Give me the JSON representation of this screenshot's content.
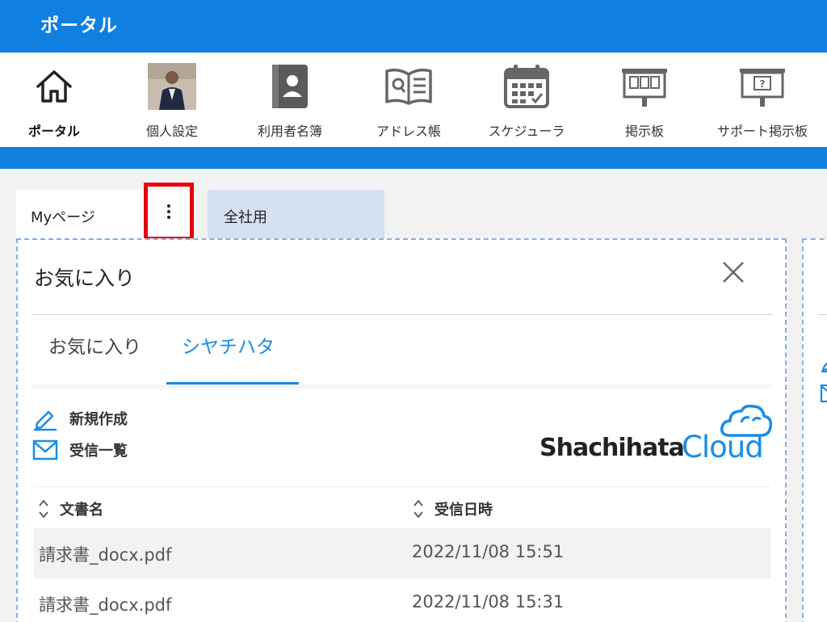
{
  "header": {
    "title": "ポータル"
  },
  "apps": [
    {
      "label": "ポータル",
      "icon": "home-icon",
      "active": true
    },
    {
      "label": "個人設定",
      "icon": "user-photo-avatar"
    },
    {
      "label": "利用者名簿",
      "icon": "contact-book-icon"
    },
    {
      "label": "アドレス帳",
      "icon": "address-book-icon"
    },
    {
      "label": "スケジューラ",
      "icon": "calendar-icon"
    },
    {
      "label": "掲示板",
      "icon": "bulletin-board-icon"
    },
    {
      "label": "サポート掲示板",
      "icon": "support-board-icon"
    }
  ],
  "page_tabs": {
    "my": "Myページ",
    "company": "全社用"
  },
  "widget": {
    "title": "お気に入り",
    "tabs": [
      "お気に入り",
      "シヤチハタ"
    ],
    "active_tab": 1,
    "actions": {
      "new": "新規作成",
      "inbox": "受信一覧"
    },
    "logo": {
      "word1": "Shachihata",
      "word2": "Cloud"
    },
    "table": {
      "headers": [
        "文書名",
        "受信日時"
      ],
      "rows": [
        [
          "請求書_docx.pdf",
          "2022/11/08 15:51"
        ],
        [
          "請求書_docx.pdf",
          "2022/11/08 15:31"
        ]
      ]
    }
  },
  "colors": {
    "brand_blue": "#0f7fe0",
    "accent": "#1a8ce6",
    "highlight": "#e3000f",
    "tab_inactive": "#d5e0f1"
  }
}
